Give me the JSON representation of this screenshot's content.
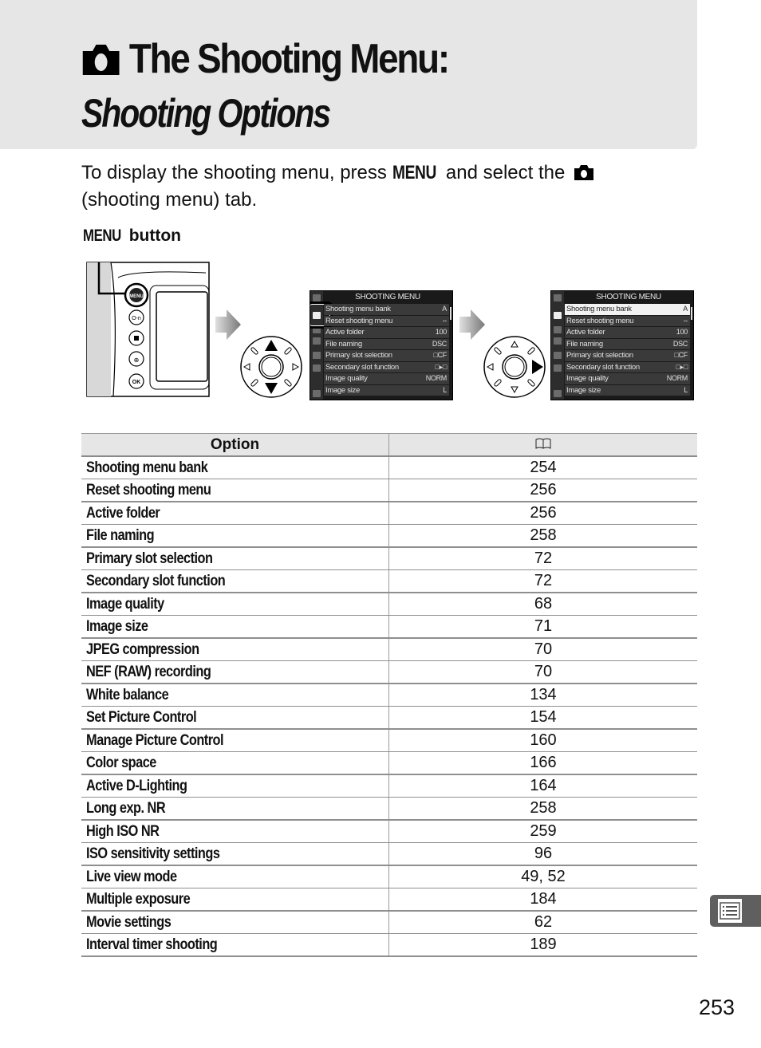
{
  "header": {
    "title_icon": "camera-icon",
    "title": "The Shooting Menu:",
    "subtitle": "Shooting Options"
  },
  "intro": {
    "text_before": "To display the shooting menu, press",
    "menu_keyword": "MENU",
    "text_middle": "and select the",
    "tab_icon": "camera-icon",
    "text_after": "(shooting menu) tab."
  },
  "figure": {
    "label_keyword": "MENU",
    "label_text": "button",
    "camera_buttons": [
      "MENU",
      "O-n",
      "Q",
      "zoom",
      "OK"
    ],
    "screens": [
      {
        "title": "SHOOTING MENU",
        "highlighted": "tab",
        "rows": [
          {
            "label": "Shooting menu bank",
            "value": "A"
          },
          {
            "label": "Reset shooting menu",
            "value": "--"
          },
          {
            "label": "Active folder",
            "value": "100"
          },
          {
            "label": "File naming",
            "value": "DSC"
          },
          {
            "label": "Primary slot selection",
            "value": "□CF"
          },
          {
            "label": "Secondary slot function",
            "value": "□▸□"
          },
          {
            "label": "Image quality",
            "value": "NORM"
          },
          {
            "label": "Image size",
            "value": "L"
          }
        ]
      },
      {
        "title": "SHOOTING MENU",
        "highlighted": "Shooting menu bank",
        "rows": [
          {
            "label": "Shooting menu bank",
            "value": "A"
          },
          {
            "label": "Reset shooting menu",
            "value": "--"
          },
          {
            "label": "Active folder",
            "value": "100"
          },
          {
            "label": "File naming",
            "value": "DSC"
          },
          {
            "label": "Primary slot selection",
            "value": "□CF"
          },
          {
            "label": "Secondary slot function",
            "value": "□▸□"
          },
          {
            "label": "Image quality",
            "value": "NORM"
          },
          {
            "label": "Image size",
            "value": "L"
          }
        ]
      }
    ]
  },
  "table": {
    "headers": {
      "option": "Option",
      "page_icon": "book-icon"
    },
    "rows": [
      {
        "option": "Shooting menu bank",
        "page": "254"
      },
      {
        "option": "Reset shooting menu",
        "page": "256"
      },
      {
        "option": "Active folder",
        "page": "256"
      },
      {
        "option": "File naming",
        "page": "258"
      },
      {
        "option": "Primary slot selection",
        "page": "72"
      },
      {
        "option": "Secondary slot function",
        "page": "72"
      },
      {
        "option": "Image quality",
        "page": "68"
      },
      {
        "option": "Image size",
        "page": "71"
      },
      {
        "option": "JPEG compression",
        "page": "70"
      },
      {
        "option": "NEF (RAW) recording",
        "page": "70"
      },
      {
        "option": "White balance",
        "page": "134"
      },
      {
        "option": "Set Picture Control",
        "page": "154"
      },
      {
        "option": "Manage Picture Control",
        "page": "160"
      },
      {
        "option": "Color space",
        "page": "166"
      },
      {
        "option": "Active D-Lighting",
        "page": "164"
      },
      {
        "option": "Long exp.  NR",
        "page": "258"
      },
      {
        "option": "High ISO NR",
        "page": "259"
      },
      {
        "option": "ISO sensitivity settings",
        "page": "96"
      },
      {
        "option": "Live view mode",
        "page": "49, 52"
      },
      {
        "option": "Multiple exposure",
        "page": "184"
      },
      {
        "option": "Movie settings",
        "page": "62"
      },
      {
        "option": "Interval timer shooting",
        "page": "189"
      }
    ]
  },
  "side_tab": {
    "icon": "menu-list-icon"
  },
  "footer": {
    "page_number": "253"
  }
}
